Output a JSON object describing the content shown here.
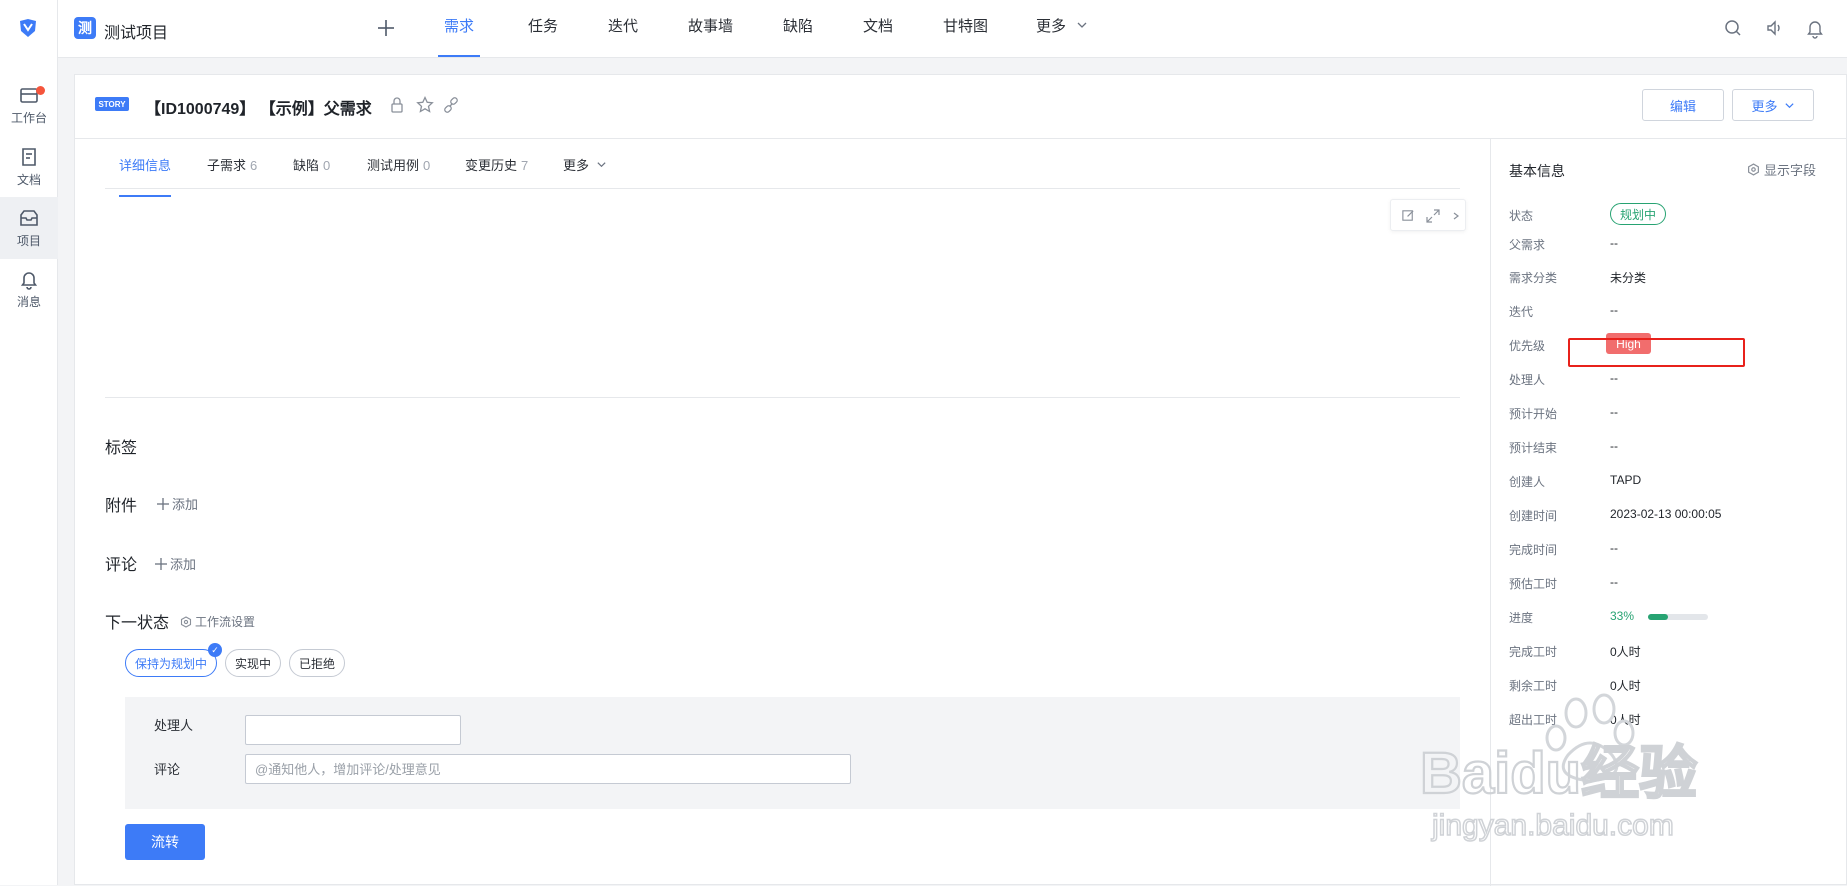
{
  "rail": {
    "items": [
      {
        "label": "工作台",
        "icon": "workbench-icon"
      },
      {
        "label": "文档",
        "icon": "document-icon"
      },
      {
        "label": "项目",
        "icon": "project-icon"
      },
      {
        "label": "消息",
        "icon": "bell-icon"
      }
    ]
  },
  "topbar": {
    "project_icon": "测",
    "project_name": "测试项目",
    "nav": [
      "需求",
      "任务",
      "迭代",
      "故事墙",
      "缺陷",
      "文档",
      "甘特图",
      "更多"
    ],
    "active_nav": "需求"
  },
  "story": {
    "badge": "STORY",
    "title": "【ID1000749】 【示例】父需求",
    "edit_label": "编辑",
    "more_label": "更多"
  },
  "tabs": [
    {
      "label": "详细信息",
      "count": ""
    },
    {
      "label": "子需求",
      "count": "6"
    },
    {
      "label": "缺陷",
      "count": "0"
    },
    {
      "label": "测试用例",
      "count": "0"
    },
    {
      "label": "变更历史",
      "count": "7"
    },
    {
      "label": "更多",
      "count": ""
    }
  ],
  "sections": {
    "tags": "标签",
    "attachments": "附件",
    "comments": "评论",
    "add": "添加",
    "next_state": "下一状态",
    "workflow_settings": "工作流设置"
  },
  "states": [
    "保持为规划中",
    "实现中",
    "已拒绝"
  ],
  "form": {
    "handler_label": "处理人",
    "handler_value": "",
    "comment_label": "评论",
    "comment_placeholder": "@通知他人，增加评论/处理意见",
    "submit_label": "流转"
  },
  "panel": {
    "title": "基本信息",
    "show_fields": "显示字段",
    "rows": [
      {
        "key": "状态",
        "value": "规划中"
      },
      {
        "key": "父需求",
        "value": "--"
      },
      {
        "key": "需求分类",
        "value": "未分类"
      },
      {
        "key": "迭代",
        "value": "--"
      },
      {
        "key": "优先级",
        "value": "High"
      },
      {
        "key": "处理人",
        "value": "--"
      },
      {
        "key": "预计开始",
        "value": "--"
      },
      {
        "key": "预计结束",
        "value": "--"
      },
      {
        "key": "创建人",
        "value": "TAPD"
      },
      {
        "key": "创建时间",
        "value": "2023-02-13 00:00:05"
      },
      {
        "key": "完成时间",
        "value": "--"
      },
      {
        "key": "预估工时",
        "value": "--"
      },
      {
        "key": "进度",
        "value": "33%"
      },
      {
        "key": "完成工时",
        "value": "0人时"
      },
      {
        "key": "剩余工时",
        "value": "0人时"
      },
      {
        "key": "超出工时",
        "value": "0人时"
      }
    ],
    "progress_fraction": 0.33
  },
  "watermark": {
    "brand": "Baidu经验",
    "url": "jingyan.baidu.com"
  },
  "colors": {
    "accent": "#3d7bf7",
    "status_green": "#27a372",
    "priority_high": "#f16d6d",
    "highlight_red": "#e8211b"
  }
}
